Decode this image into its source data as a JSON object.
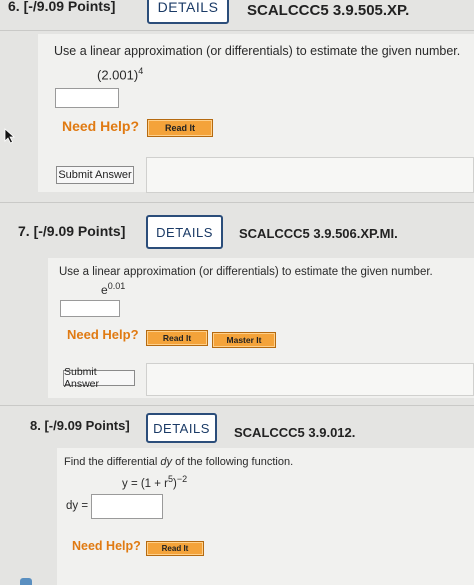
{
  "q6": {
    "header": "6.  [-/9.09 Points]",
    "details_label": "DETAILS",
    "code": "SCALCCC5 3.9.505.XP.",
    "prompt": "Use a linear approximation (or differentials) to estimate the given number.",
    "expr_base": "(2.001)",
    "expr_exp": "4",
    "need_help": "Need Help?",
    "read_it": "Read It",
    "submit": "Submit Answer"
  },
  "q7": {
    "header": "7.  [-/9.09 Points]",
    "details_label": "DETAILS",
    "code": "SCALCCC5 3.9.506.XP.MI.",
    "prompt": "Use a linear approximation (or differentials) to estimate the given number.",
    "expr_base": "e",
    "expr_exp": "0.01",
    "need_help": "Need Help?",
    "read_it": "Read It",
    "master_it": "Master It",
    "submit": "Submit Answer"
  },
  "q8": {
    "header": "8.  [-/9.09 Points]",
    "details_label": "DETAILS",
    "code": "SCALCCC5 3.9.012.",
    "prompt_pre": "Find the differential ",
    "prompt_var": "dy",
    "prompt_post": " of the following function.",
    "func_left": "y = (1 + r",
    "func_exp1": "5",
    "func_mid": ")",
    "func_exp2": "−2",
    "answer_label": "dy =",
    "need_help": "Need Help?",
    "read_it": "Read It"
  },
  "colors": {
    "help_orange": "#e07a12",
    "button_orange": "#f4a33a",
    "details_border": "#2b4d7a"
  },
  "icons": {
    "cursor": "mouse-pointer-icon"
  }
}
